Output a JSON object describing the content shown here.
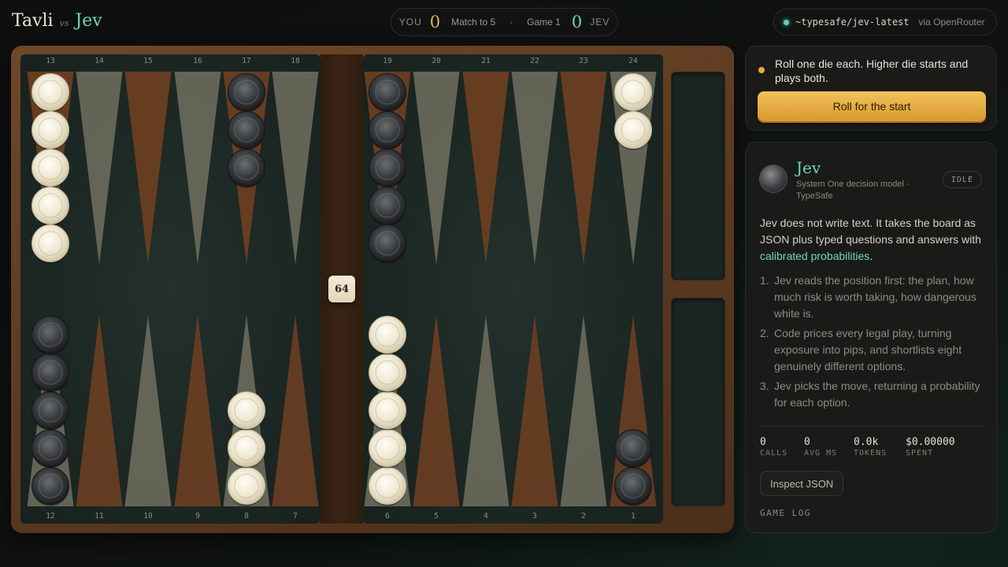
{
  "header": {
    "player_name": "Tavli",
    "vs": "vs",
    "opponent_name": "Jev"
  },
  "score": {
    "you_label": "YOU",
    "you_score": "0",
    "match_text": "Match to 5",
    "separator": "·",
    "game_text": "Game 1",
    "opp_score": "0",
    "opp_label": "JEV"
  },
  "model": {
    "name": "~typesafe/jev-latest",
    "via": "via OpenRouter",
    "status_color": "#5fd0b7"
  },
  "board": {
    "top_numbers": [
      "13",
      "14",
      "15",
      "16",
      "17",
      "18",
      "19",
      "20",
      "21",
      "22",
      "23",
      "24"
    ],
    "bottom_numbers": [
      "12",
      "11",
      "10",
      "9",
      "8",
      "7",
      "6",
      "5",
      "4",
      "3",
      "2",
      "1"
    ],
    "cube_value": "64",
    "colors": {
      "white_checker": "#efe8d4",
      "black_checker": "#3a3d40",
      "point_dark": "#6b3e22",
      "point_light": "#6c6c5c"
    },
    "checkers": [
      {
        "point": 13,
        "color": "white",
        "count": 5
      },
      {
        "point": 17,
        "color": "black",
        "count": 3
      },
      {
        "point": 19,
        "color": "black",
        "count": 5
      },
      {
        "point": 24,
        "color": "white",
        "count": 2
      },
      {
        "point": 12,
        "color": "black",
        "count": 5
      },
      {
        "point": 8,
        "color": "white",
        "count": 3
      },
      {
        "point": 6,
        "color": "white",
        "count": 5
      },
      {
        "point": 1,
        "color": "black",
        "count": 2
      }
    ]
  },
  "roll": {
    "message": "Roll one die each. Higher die starts and plays both.",
    "button_label": "Roll for the start",
    "accent": "#e8a93c"
  },
  "jev": {
    "name": "Jev",
    "subtitle": "System One decision model · TypeSafe",
    "status": "IDLE",
    "desc_pre": "Jev does not write text. It takes the board as JSON plus typed questions and answers with ",
    "desc_link": "calibrated probabilities",
    "desc_post": ".",
    "steps": [
      {
        "n": "1.",
        "text": "Jev reads the position first: the plan, how much risk is worth taking, how dangerous white is."
      },
      {
        "n": "2.",
        "text": "Code prices every legal play, turning exposure into pips, and shortlists eight genuinely different options."
      },
      {
        "n": "3.",
        "text": "Jev picks the move, returning a probability for each option."
      }
    ],
    "stats": [
      {
        "value": "0",
        "label": "CALLS"
      },
      {
        "value": "0",
        "label": "AVG MS"
      },
      {
        "value": "0.0k",
        "label": "TOKENS"
      },
      {
        "value": "$0.00000",
        "label": "SPENT"
      }
    ],
    "inspect_label": "Inspect JSON",
    "log_label": "GAME LOG"
  }
}
